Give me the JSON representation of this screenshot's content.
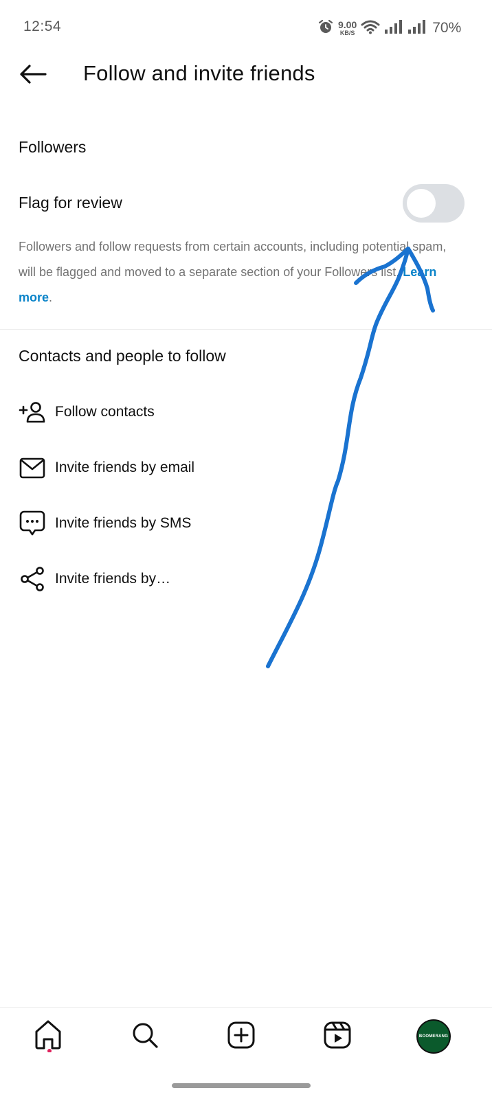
{
  "status_bar": {
    "time": "12:54",
    "net_speed_value": "9.00",
    "net_speed_unit": "KB/S",
    "battery": "70%",
    "icons": [
      "alarm-icon",
      "wifi-icon",
      "signal-icon",
      "signal-icon"
    ]
  },
  "header": {
    "back_icon": "arrow-left-icon",
    "title": "Follow and invite friends"
  },
  "followers_section": {
    "title": "Followers",
    "flag_label": "Flag for review",
    "flag_enabled": false,
    "description": "Followers and follow requests from certain accounts,  including potential spam,  will be flagged and moved to a separate section of  your Followers list. ",
    "learn_more": "Learn more",
    "learn_more_suffix": "."
  },
  "contacts_section": {
    "title": "Contacts and people to follow",
    "items": [
      {
        "label": "Follow contacts",
        "icon": "add-person-icon"
      },
      {
        "label": "Invite friends by email",
        "icon": "envelope-icon"
      },
      {
        "label": "Invite friends by SMS",
        "icon": "chat-bubble-icon"
      },
      {
        "label": "Invite friends by…",
        "icon": "share-icon"
      }
    ]
  },
  "bottom_nav": {
    "items": [
      "home-icon",
      "search-icon",
      "create-icon",
      "reels-icon",
      "profile-avatar"
    ],
    "avatar_text": "BOOMERANG",
    "notification_dot": true
  },
  "colors": {
    "accent": "#0b84c9",
    "annotation": "#1a73d0",
    "toggle_off": "#dcdfe3",
    "avatar_bg": "#0b5a2c"
  }
}
